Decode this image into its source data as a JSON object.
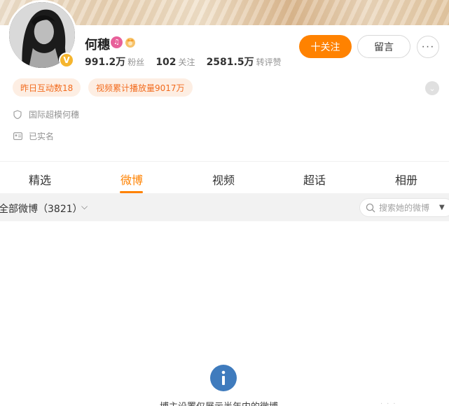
{
  "profile": {
    "name": "何穗",
    "verified_icon": "v-badge-icon",
    "stats": [
      {
        "value": "991.2万",
        "label": "粉丝"
      },
      {
        "value": "102",
        "label": "关注"
      },
      {
        "value": "2581.5万",
        "label": "转评赞"
      }
    ],
    "follow_label": "十关注",
    "message_label": "留言",
    "more_label": "···",
    "tags": [
      "昨日互动数18",
      "视频累计播放量9017万"
    ],
    "bio": "国际超模何穗",
    "real_name": "已实名"
  },
  "tabs": {
    "items": [
      "精选",
      "微博",
      "视频",
      "超话",
      "相册"
    ],
    "active": "微博"
  },
  "filter": {
    "label": "全部微博（3821）",
    "search_placeholder": "搜索她的微博"
  },
  "notice": {
    "text": "博主设置仅展示半年内的微博"
  },
  "colors": {
    "accent": "#ff8200",
    "tag_bg": "#fdeee3",
    "tag_text": "#f26b1d",
    "info_blue": "#3f7bbd"
  }
}
